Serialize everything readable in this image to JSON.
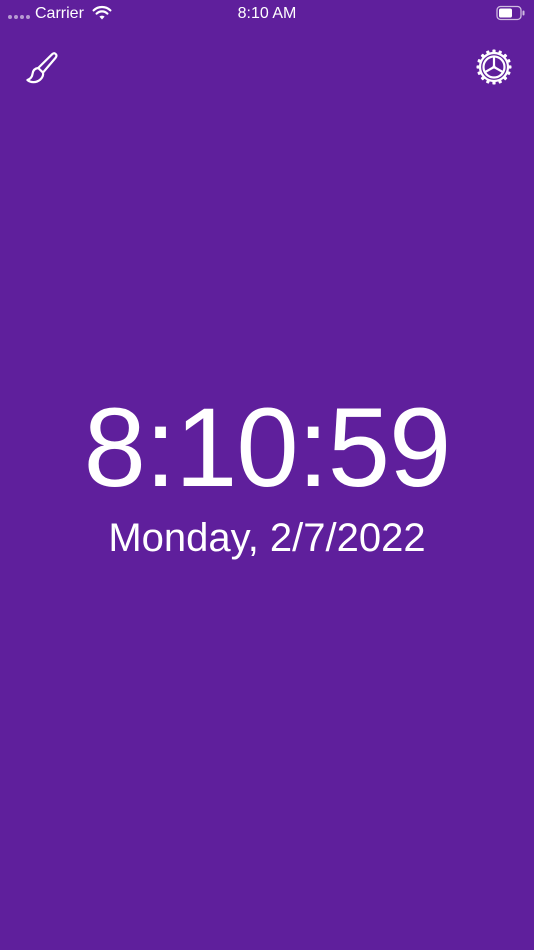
{
  "status_bar": {
    "carrier": "Carrier",
    "time": "8:10 AM",
    "wifi_icon": "wifi-icon",
    "battery_icon": "battery-icon"
  },
  "toolbar": {
    "theme_icon": "paintbrush-icon",
    "settings_icon": "gear-icon"
  },
  "clock": {
    "time": "8:10:59",
    "date": "Monday, 2/7/2022"
  },
  "colors": {
    "background": "#5f1f9c",
    "foreground": "#ffffff"
  }
}
